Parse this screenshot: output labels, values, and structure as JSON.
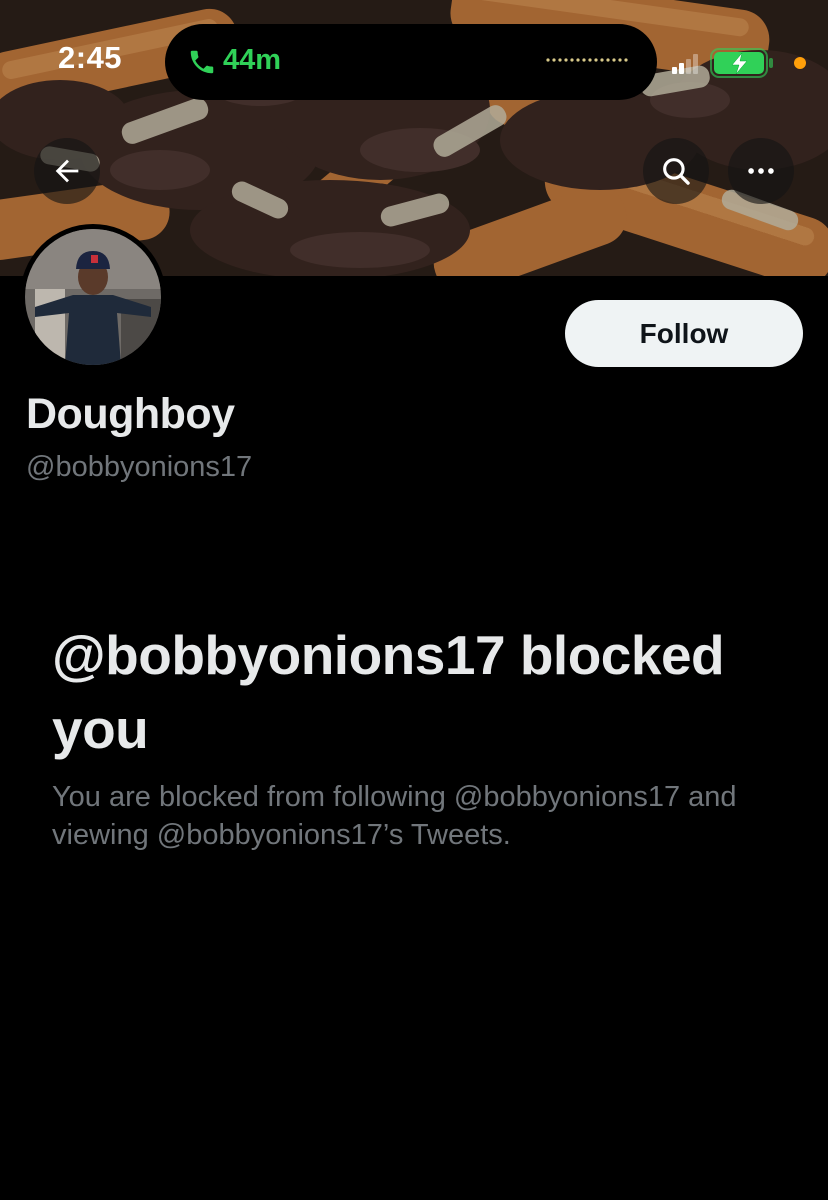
{
  "status_bar": {
    "time": "2:45",
    "call_duration": "44m",
    "call_color": "#30d158",
    "privacy_indicator_color": "#ff9f0a",
    "icons": [
      "phone-icon",
      "cellular-signal-icon",
      "battery-charging-icon"
    ]
  },
  "header": {
    "back_icon": "arrow-left-icon",
    "search_icon": "search-icon",
    "more_icon": "more-horizontal-icon"
  },
  "profile": {
    "display_name": "Doughboy",
    "handle": "@bobbyonions17",
    "follow_label": "Follow"
  },
  "blocked": {
    "title": "@bobbyonions17 blocked you",
    "description": "You are blocked from following @bobbyonions17 and viewing @bobbyonions17’s Tweets."
  },
  "colors": {
    "background": "#000000",
    "primary_text": "#e7e9ea",
    "secondary_text": "#71767b",
    "follow_button_bg": "#eff3f4"
  }
}
